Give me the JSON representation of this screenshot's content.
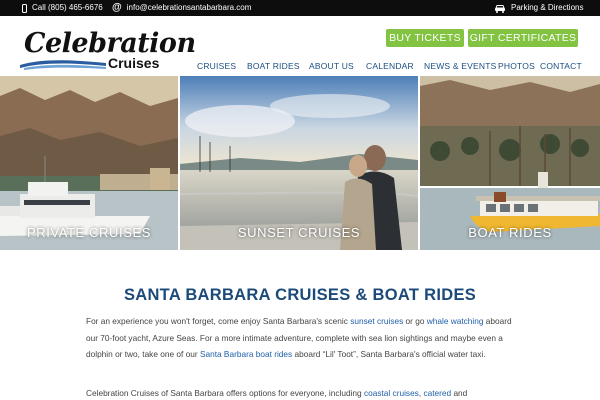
{
  "topbar": {
    "phone": "Call (805) 465-6676",
    "email": "info@celebrationsantabarbara.com",
    "parking": "Parking & Directions",
    "icons": [
      "phone-icon",
      "at-icon",
      "car-icon"
    ]
  },
  "logo": {
    "script": "Celebration",
    "sub": "Cruises"
  },
  "buttons": {
    "buy_tickets": "BUY TICKETS",
    "gift_certificates": "GIFT CERTIFICATES"
  },
  "nav": [
    "CRUISES",
    "BOAT RIDES",
    "ABOUT US",
    "CALENDAR",
    "NEWS & EVENTS",
    "PHOTOS",
    "CONTACT"
  ],
  "hero": {
    "panels": [
      {
        "label": "PRIVATE CRUISES"
      },
      {
        "label": "SUNSET CRUISES"
      },
      {
        "label": "BOAT RIDES"
      }
    ]
  },
  "content": {
    "headline": "SANTA BARBARA CRUISES & BOAT RIDES",
    "p1": {
      "t1": "For an experience you won't forget, come enjoy Santa Barbara's scenic ",
      "l1": "sunset cruises",
      "t2": " or go ",
      "l2": "whale watching",
      "t3": " aboard our 70-foot yacht, Azure Seas. For a more intimate adventure, complete with sea lion sightings and maybe even a dolphin or two, take one of our ",
      "l3": "Santa Barbara boat rides",
      "t4": " aboard “Lil' Toot”, Santa Barbara's official water taxi."
    },
    "p2": {
      "t1": "Celebration Cruises of Santa Barbara offers options for everyone, including ",
      "l1": "coastal cruises",
      "t2": ", ",
      "l2": "catered",
      "t3": " and"
    }
  },
  "colors": {
    "accent_green": "#82c341",
    "nav_blue": "#1c4e80",
    "link_blue": "#1f5fa8",
    "topbar_bg": "#0d0d0d"
  }
}
